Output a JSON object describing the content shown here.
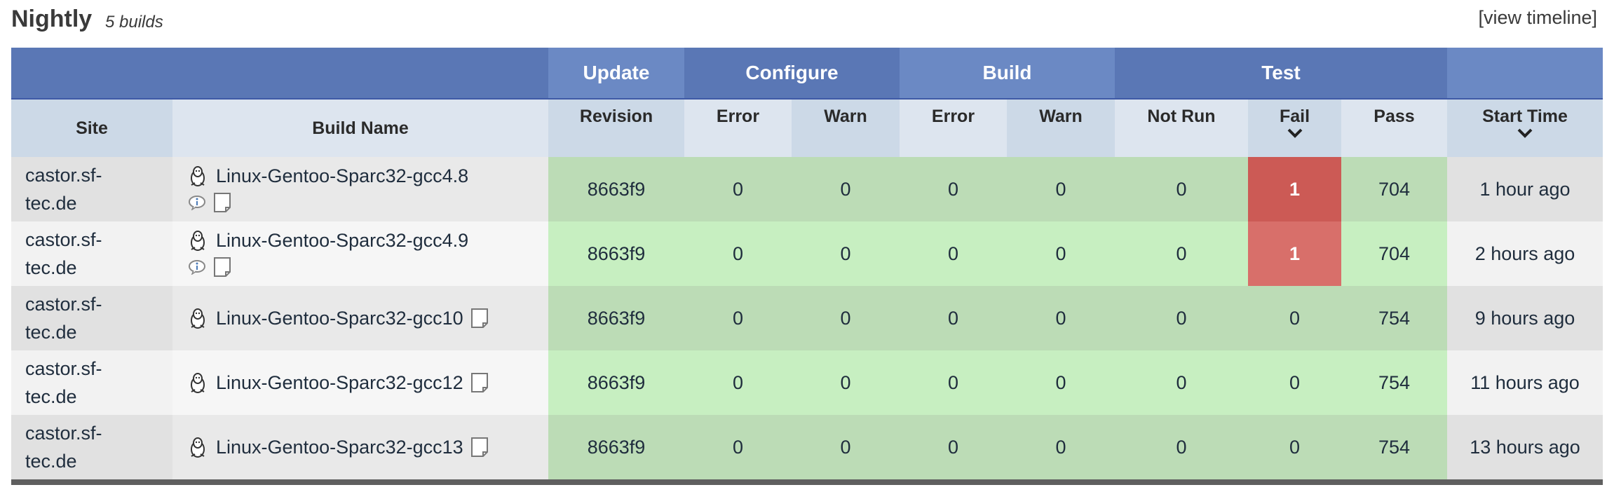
{
  "header": {
    "title": "Nightly",
    "subtitle": "5 builds",
    "timeline_link": "[view timeline]"
  },
  "groups": {
    "update": "Update",
    "configure": "Configure",
    "build": "Build",
    "test": "Test"
  },
  "columns": {
    "site": "Site",
    "build_name": "Build Name",
    "revision": "Revision",
    "configure_error": "Error",
    "configure_warn": "Warn",
    "build_error": "Error",
    "build_warn": "Warn",
    "not_run": "Not Run",
    "fail": "Fail",
    "pass": "Pass",
    "start_time": "Start Time"
  },
  "rows": [
    {
      "site_line1": "castor.sf-",
      "site_line2": "tec.de",
      "build_name": "Linux-Gentoo-Sparc32-gcc4.8",
      "revision": "8663f9",
      "configure_error": "0",
      "configure_warn": "0",
      "build_error": "0",
      "build_warn": "0",
      "not_run": "0",
      "fail": "1",
      "pass": "704",
      "start_time": "1 hour ago"
    },
    {
      "site_line1": "castor.sf-",
      "site_line2": "tec.de",
      "build_name": "Linux-Gentoo-Sparc32-gcc4.9",
      "revision": "8663f9",
      "configure_error": "0",
      "configure_warn": "0",
      "build_error": "0",
      "build_warn": "0",
      "not_run": "0",
      "fail": "1",
      "pass": "704",
      "start_time": "2 hours ago"
    },
    {
      "site_line1": "castor.sf-",
      "site_line2": "tec.de",
      "build_name": "Linux-Gentoo-Sparc32-gcc10",
      "revision": "8663f9",
      "configure_error": "0",
      "configure_warn": "0",
      "build_error": "0",
      "build_warn": "0",
      "not_run": "0",
      "fail": "0",
      "pass": "754",
      "start_time": "9 hours ago"
    },
    {
      "site_line1": "castor.sf-",
      "site_line2": "tec.de",
      "build_name": "Linux-Gentoo-Sparc32-gcc12",
      "revision": "8663f9",
      "configure_error": "0",
      "configure_warn": "0",
      "build_error": "0",
      "build_warn": "0",
      "not_run": "0",
      "fail": "0",
      "pass": "754",
      "start_time": "11 hours ago"
    },
    {
      "site_line1": "castor.sf-",
      "site_line2": "tec.de",
      "build_name": "Linux-Gentoo-Sparc32-gcc13",
      "revision": "8663f9",
      "configure_error": "0",
      "configure_warn": "0",
      "build_error": "0",
      "build_warn": "0",
      "not_run": "0",
      "fail": "0",
      "pass": "754",
      "start_time": "13 hours ago"
    }
  ],
  "icons": {
    "os": "linux-penguin-icon",
    "note": "note-icon",
    "info": "info-icon",
    "sort": "chevron-down-icon"
  },
  "colors": {
    "header_blue": "#5a77b5",
    "header_blue_light": "#6b89c4",
    "pass_green": "#bcdcb6",
    "pass_green_light": "#c7efc1",
    "fail_red": "#cc5a55",
    "fail_red_light": "#d86f6a"
  }
}
